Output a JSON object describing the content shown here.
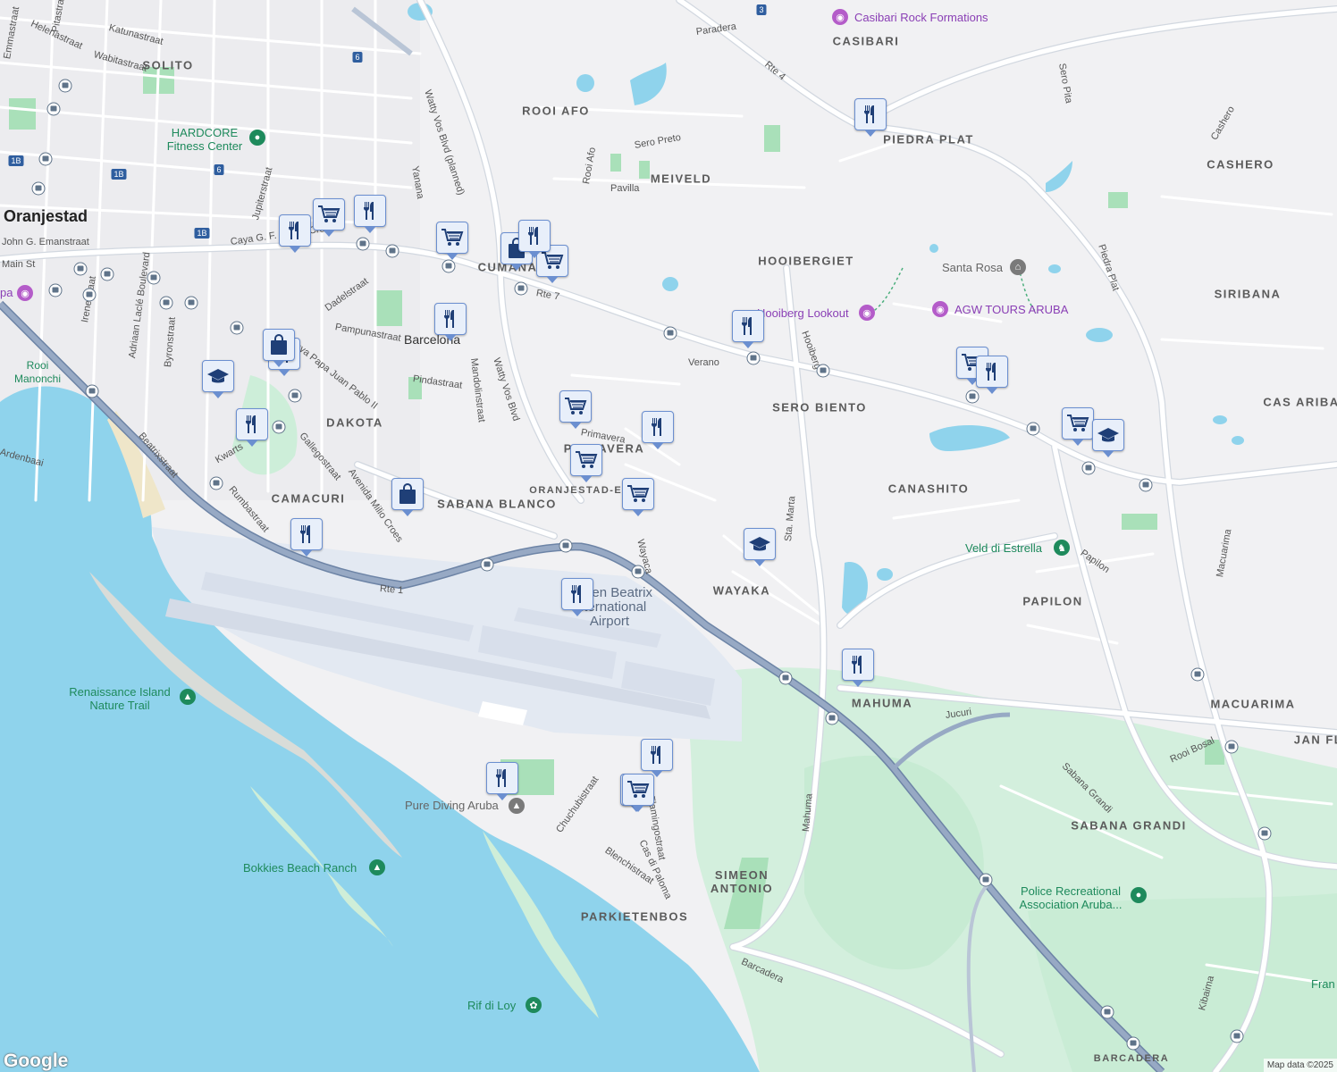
{
  "branding": {
    "logo_text": "Google",
    "attribution": "Map data ©2025"
  },
  "cities": [
    {
      "name": "Oranjestad"
    }
  ],
  "areas": [
    "SOLITO",
    "ROOI AFO",
    "MEIVELD",
    "CASIBARI",
    "PIEDRA PLAT",
    "CASHERO",
    "HOOIBERGIET",
    "SIRIBANA",
    "SERO BIENTO",
    "CAS ARIBA",
    "CANASHITO",
    "DAKOTA",
    "CAMACURI",
    "SABANA BLANCO",
    "ORANJESTAD-EA",
    "WAYAKA",
    "PAPILON",
    "MAHUMA",
    "MACUARIMA",
    "JAN FL",
    "SABANA GRANDI",
    "SIMEON\nANTONIO",
    "PARKIETENBOS",
    "BARCADERA",
    "Barcelona",
    "CUMANA",
    "PRIMAVERA"
  ],
  "streets": [
    "Emmastraat",
    "Helenastraat",
    "Pitastraat",
    "Katunastraat",
    "Wabitastraat",
    "Watty Vos Blvd (planned)",
    "Paradera",
    "Rte 4",
    "Sero Pita",
    "Cashero",
    "Sero Preto",
    "Pavilla",
    "Rooi Afo",
    "Yanana",
    "Jupiterstraat",
    "John G. Emanstraat",
    "Main St",
    "Caya G. F. Betico Croes",
    "Rte 7",
    "Dadelstraat",
    "Pampunastraat",
    "Caya Papa Juan Pablo II",
    "Pindastraat",
    "Mandolinstraat",
    "Watty Vos Blvd",
    "Irenestraat",
    "Adriaan Laclé Boulevard",
    "Byronstraat",
    "Beatrixstraat",
    "Gallegostraat",
    "Avenida Milio Croes",
    "Rumbastraat",
    "Kwarts",
    "Verano",
    "Hooiberg",
    "Piedra Plat",
    "Sta. Marta",
    "Wayaca",
    "Rte 1",
    "Jucuri",
    "Papilon",
    "Macuarima",
    "Rooi Bosal",
    "Sabana Grandi",
    "Mahuma",
    "Chuchubistraat",
    "Flamingostraat",
    "Cas di Paloma",
    "Blenchistraat",
    "Barcadera",
    "Kibaima",
    "Primavera",
    "Ardenbaai"
  ],
  "pois": [
    {
      "name": "Casibari Rock Formations",
      "kind": "attraction"
    },
    {
      "name": "HARDCORE\nFitness Center",
      "kind": "fitness"
    },
    {
      "name": "Santa Rosa",
      "kind": "museum"
    },
    {
      "name": "Hooiberg Lookout",
      "kind": "attraction"
    },
    {
      "name": "AGW TOURS ARUBA",
      "kind": "attraction"
    },
    {
      "name": "Rooi\nManonchi",
      "kind": "park"
    },
    {
      "name": "Veld di Estrella",
      "kind": "park"
    },
    {
      "name": "Queen Beatrix\nInternational\nAirport",
      "kind": "airport"
    },
    {
      "name": "Renaissance Island\nNature Trail",
      "kind": "park"
    },
    {
      "name": "Pure Diving Aruba",
      "kind": "school"
    },
    {
      "name": "Bokkies Beach Ranch",
      "kind": "camp"
    },
    {
      "name": "Police Recreational\nAssociation Aruba...",
      "kind": "park"
    },
    {
      "name": "Rif di Loy",
      "kind": "park"
    },
    {
      "name": "Fran",
      "kind": "other"
    },
    {
      "name": "pa",
      "kind": "attraction"
    }
  ],
  "route_shields": [
    "1B",
    "1B",
    "1B",
    "6",
    "6",
    "3"
  ],
  "markers": [
    {
      "type": "restaurant",
      "icon": "fork-knife-icon"
    },
    {
      "type": "grocery",
      "icon": "shopping-cart-icon"
    },
    {
      "type": "restaurant",
      "icon": "fork-knife-icon"
    },
    {
      "type": "grocery",
      "icon": "shopping-cart-icon"
    },
    {
      "type": "restaurant",
      "icon": "fork-knife-icon"
    },
    {
      "type": "shopping",
      "icon": "shopping-bag-icon"
    },
    {
      "type": "grocery",
      "icon": "shopping-cart-icon"
    },
    {
      "type": "restaurant",
      "icon": "fork-knife-icon"
    },
    {
      "type": "restaurant",
      "icon": "fork-knife-icon"
    },
    {
      "type": "restaurant",
      "icon": "fork-knife-icon"
    },
    {
      "type": "shopping",
      "icon": "shopping-bag-icon"
    },
    {
      "type": "restaurant",
      "icon": "fork-knife-icon"
    },
    {
      "type": "school",
      "icon": "graduation-cap-icon"
    },
    {
      "type": "restaurant",
      "icon": "fork-knife-icon"
    },
    {
      "type": "shopping",
      "icon": "shopping-bag-icon"
    },
    {
      "type": "restaurant",
      "icon": "fork-knife-icon"
    },
    {
      "type": "grocery",
      "icon": "shopping-cart-icon"
    },
    {
      "type": "restaurant",
      "icon": "fork-knife-icon"
    },
    {
      "type": "grocery",
      "icon": "shopping-cart-icon"
    },
    {
      "type": "grocery",
      "icon": "shopping-cart-icon"
    },
    {
      "type": "school",
      "icon": "graduation-cap-icon"
    },
    {
      "type": "restaurant",
      "icon": "fork-knife-icon"
    },
    {
      "type": "restaurant",
      "icon": "fork-knife-icon"
    },
    {
      "type": "grocery",
      "icon": "shopping-cart-icon"
    },
    {
      "type": "restaurant",
      "icon": "fork-knife-icon"
    },
    {
      "type": "grocery",
      "icon": "shopping-cart-icon"
    },
    {
      "type": "school",
      "icon": "graduation-cap-icon"
    },
    {
      "type": "restaurant",
      "icon": "fork-knife-icon"
    },
    {
      "type": "restaurant",
      "icon": "fork-knife-icon"
    },
    {
      "type": "grocery",
      "icon": "shopping-cart-icon"
    },
    {
      "type": "grocery",
      "icon": "shopping-cart-icon"
    }
  ],
  "colors": {
    "land": "#f1f1f3",
    "water": "#8fd3ec",
    "park": "#cdeed9",
    "park_dark": "#a9e0b9",
    "airport": "#e6ebf3",
    "runway": "#d8dfeb",
    "highway": "#8a9fbd",
    "road": "#ffffff",
    "road_outline": "#d2d8e0",
    "marker_icon": "#1f3f77"
  }
}
